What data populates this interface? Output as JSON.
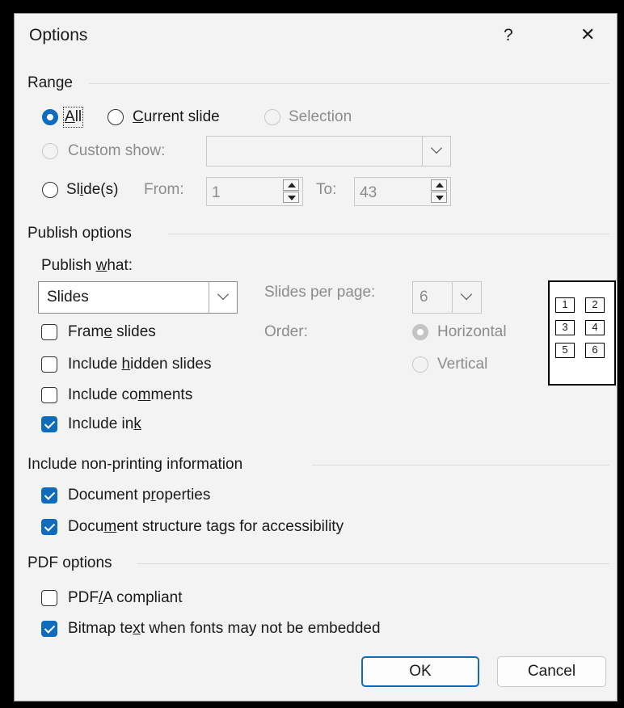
{
  "dialog": {
    "title": "Options",
    "help": "?",
    "close": "✕"
  },
  "range": {
    "header": "Range",
    "all_u": "A",
    "all_rest": "ll",
    "current_u": "C",
    "current_rest": "urrent slide",
    "selection": "Selection",
    "custom_show": "Custom show:",
    "custom_show_value": "",
    "slides_a": "Sl",
    "slides_u": "i",
    "slides_b": "de(s)",
    "from_label": "From:",
    "from_value": "1",
    "to_label": "To:",
    "to_value": "43"
  },
  "publish": {
    "header": "Publish options",
    "what_a": "Publish ",
    "what_u": "w",
    "what_b": "hat:",
    "what_value": "Slides",
    "spp_label": "Slides per page:",
    "spp_value": "6",
    "order_label": "Order:",
    "horizontal": "Horizontal",
    "vertical": "Vertical",
    "frame_a": "Fram",
    "frame_u": "e",
    "frame_b": " slides",
    "hidden_a": "Include ",
    "hidden_u": "h",
    "hidden_b": "idden slides",
    "comments_a": "Include co",
    "comments_u": "m",
    "comments_b": "ments",
    "ink_a": "Include in",
    "ink_u": "k",
    "ink_b": "",
    "grid_cells": [
      "1",
      "2",
      "3",
      "4",
      "5",
      "6"
    ],
    "checks": {
      "frame": false,
      "hidden": false,
      "comments": false,
      "ink": true
    }
  },
  "nonprint": {
    "header": "Include non-printing information",
    "props_a": "Document p",
    "props_u": "r",
    "props_b": "operties",
    "tags_a": "Docu",
    "tags_u": "m",
    "tags_b": "ent structure tags for accessibility",
    "checks": {
      "props": true,
      "tags": true
    }
  },
  "pdf": {
    "header": "PDF options",
    "pdfa_a": "PDF",
    "pdfa_u": "/",
    "pdfa_b": "A compliant",
    "bitmap_a": "Bitmap te",
    "bitmap_u": "x",
    "bitmap_b": "t when fonts may not be embedded",
    "checks": {
      "pdfa": false,
      "bitmap": true
    }
  },
  "buttons": {
    "ok": "OK",
    "cancel": "Cancel"
  },
  "colors": {
    "accent": "#0f6cbd",
    "background": "#f3f3f3",
    "frame": "#000000"
  }
}
